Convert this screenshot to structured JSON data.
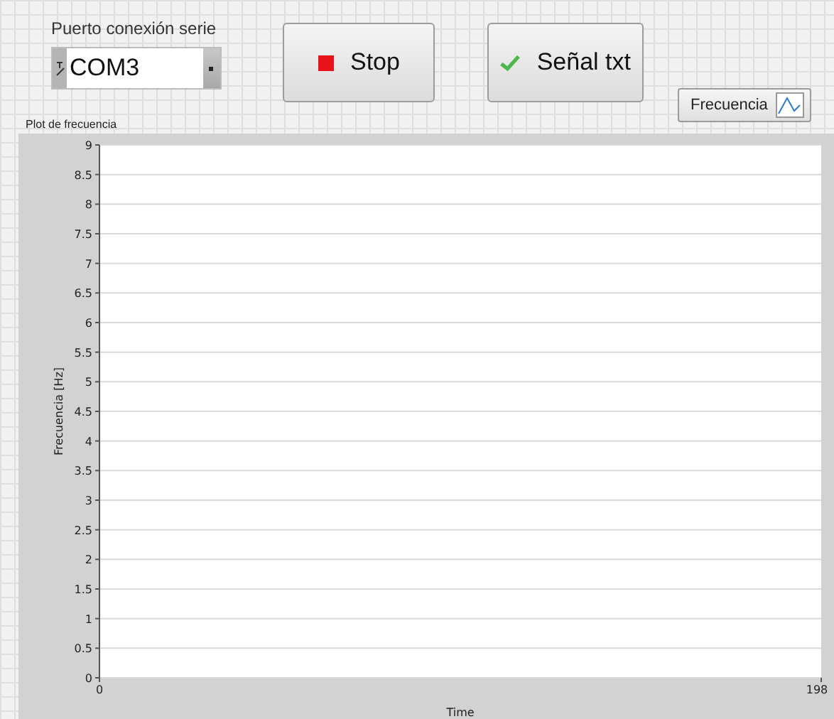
{
  "serial_port": {
    "label": "Puerto conexión serie",
    "value": "COM3"
  },
  "buttons": [
    {
      "kind": "stop",
      "label": "Stop"
    },
    {
      "kind": "check",
      "label": "Señal txt"
    }
  ],
  "legend": {
    "label": "Frecuencia"
  },
  "graph": {
    "chart_data": {
      "type": "line",
      "grid": true,
      "title": "Plot de frecuencia",
      "xlabel": "Time",
      "ylabel": "Frecuencia [Hz]",
      "xlim": [
        0,
        198
      ],
      "ylim": [
        0,
        9
      ],
      "xticks": [
        0,
        198
      ],
      "yticks": [
        0,
        0.5,
        1,
        1.5,
        2,
        2.5,
        3,
        3.5,
        4,
        4.5,
        5,
        5.5,
        6,
        6.5,
        7,
        7.5,
        8,
        8.5,
        9
      ]
    }
  }
}
